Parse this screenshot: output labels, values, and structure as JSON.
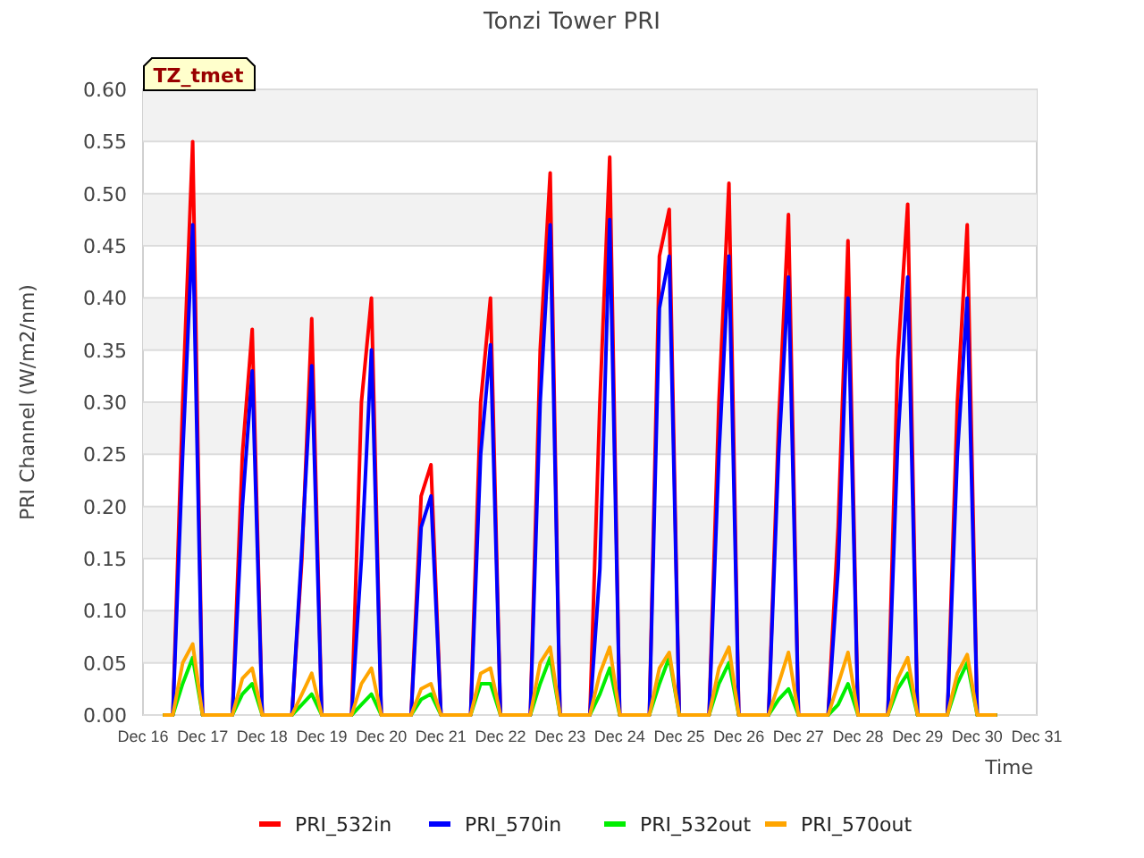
{
  "site_label": "TZ_tmet",
  "chart_data": {
    "type": "line",
    "title": "Tonzi Tower PRI",
    "xlabel": "Time",
    "ylabel": "PRI Channel (W/m2/nm)",
    "categories": [
      "Dec 16",
      null,
      null,
      null,
      null,
      null,
      "Dec 17",
      null,
      null,
      null,
      null,
      null,
      "Dec 18",
      null,
      null,
      null,
      null,
      null,
      "Dec 19",
      null,
      null,
      null,
      null,
      null,
      "Dec 20",
      null,
      null,
      null,
      null,
      null,
      "Dec 21",
      null,
      null,
      null,
      null,
      null,
      "Dec 22",
      null,
      null,
      null,
      null,
      null,
      "Dec 23",
      null,
      null,
      null,
      null,
      null,
      "Dec 24",
      null,
      null,
      null,
      null,
      null,
      "Dec 25",
      null,
      null,
      null,
      null,
      null,
      "Dec 26",
      null,
      null,
      null,
      null,
      null,
      "Dec 27",
      null,
      null,
      null,
      null,
      null,
      "Dec 28",
      null,
      null,
      null,
      null,
      null,
      "Dec 29",
      null,
      null,
      null,
      null,
      null,
      "Dec 30",
      null,
      null,
      null,
      null,
      null,
      "Dec 31"
    ],
    "series": [
      {
        "name": "PRI_532in",
        "color": "#ff0000",
        "values": [
          null,
          null,
          0,
          0,
          0.3,
          0.55,
          0,
          0,
          0,
          0,
          0.25,
          0.37,
          0,
          0,
          0,
          0,
          0.15,
          0.38,
          0,
          0,
          0,
          0,
          0.3,
          0.4,
          0,
          0,
          0,
          0,
          0.21,
          0.24,
          0,
          0,
          0,
          0,
          0.3,
          0.4,
          0,
          0,
          0,
          0,
          0.35,
          0.52,
          0,
          0,
          0,
          0,
          0.3,
          0.535,
          0,
          0,
          0,
          0,
          0.44,
          0.485,
          0,
          0,
          0,
          0,
          0.3,
          0.51,
          0,
          0,
          0,
          0,
          0.28,
          0.48,
          0,
          0,
          0,
          0,
          0.18,
          0.455,
          0,
          0,
          0,
          0,
          0.34,
          0.49,
          0,
          0,
          0,
          0,
          0.3,
          0.47,
          0,
          0,
          0,
          null,
          null,
          null,
          null
        ]
      },
      {
        "name": "PRI_570in",
        "color": "#0000ff",
        "values": [
          null,
          null,
          0,
          0,
          0.25,
          0.47,
          0,
          0,
          0,
          0,
          0.2,
          0.33,
          0,
          0,
          0,
          0,
          0.16,
          0.335,
          0,
          0,
          0,
          0,
          0.15,
          0.35,
          0,
          0,
          0,
          0,
          0.18,
          0.21,
          0,
          0,
          0,
          0,
          0.25,
          0.355,
          0,
          0,
          0,
          0,
          0.3,
          0.47,
          0,
          0,
          0,
          0,
          0.14,
          0.475,
          0,
          0,
          0,
          0,
          0.39,
          0.44,
          0,
          0,
          0,
          0,
          0.25,
          0.44,
          0,
          0,
          0,
          0,
          0.25,
          0.42,
          0,
          0,
          0,
          0,
          0.14,
          0.4,
          0,
          0,
          0,
          0,
          0.26,
          0.42,
          0,
          0,
          0,
          0,
          0.25,
          0.4,
          0,
          0,
          0,
          null,
          null,
          null,
          null
        ]
      },
      {
        "name": "PRI_532out",
        "color": "#00ee00",
        "values": [
          null,
          null,
          0,
          0,
          0.03,
          0.055,
          0,
          0,
          0,
          0,
          0.02,
          0.03,
          0,
          0,
          0,
          0,
          0.01,
          0.02,
          0,
          0,
          0,
          0,
          0.01,
          0.02,
          0,
          0,
          0,
          0,
          0.015,
          0.02,
          0,
          0,
          0,
          0,
          0.03,
          0.03,
          0,
          0,
          0,
          0,
          0.03,
          0.055,
          0,
          0,
          0,
          0,
          0.02,
          0.045,
          0,
          0,
          0,
          0,
          0.03,
          0.055,
          0,
          0,
          0,
          0,
          0.03,
          0.05,
          0,
          0,
          0,
          0,
          0.015,
          0.025,
          0,
          0,
          0,
          0,
          0.01,
          0.03,
          0,
          0,
          0,
          0,
          0.025,
          0.04,
          0,
          0,
          0,
          0,
          0.03,
          0.05,
          0,
          0,
          0,
          null,
          null,
          null,
          null
        ]
      },
      {
        "name": "PRI_570out",
        "color": "#ffa500",
        "values": [
          null,
          null,
          0,
          0,
          0.05,
          0.068,
          0,
          0,
          0,
          0,
          0.035,
          0.045,
          0,
          0,
          0,
          0,
          0.02,
          0.04,
          0,
          0,
          0,
          0,
          0.03,
          0.045,
          0,
          0,
          0,
          0,
          0.025,
          0.03,
          0,
          0,
          0,
          0,
          0.04,
          0.045,
          0,
          0,
          0,
          0,
          0.05,
          0.065,
          0,
          0,
          0,
          0,
          0.04,
          0.065,
          0,
          0,
          0,
          0,
          0.045,
          0.06,
          0,
          0,
          0,
          0,
          0.045,
          0.065,
          0,
          0,
          0,
          0,
          0.03,
          0.06,
          0,
          0,
          0,
          0,
          0.03,
          0.06,
          0,
          0,
          0,
          0,
          0.035,
          0.055,
          0,
          0,
          0,
          0,
          0.04,
          0.058,
          0,
          0,
          0,
          null,
          null,
          null,
          null
        ]
      }
    ],
    "ylim": [
      0,
      0.6
    ],
    "grid": true,
    "legend": true,
    "yticks": [
      {
        "value": 0,
        "label": "0.00"
      },
      {
        "value": 0.05,
        "label": "0.05"
      },
      {
        "value": 0.1,
        "label": "0.10"
      },
      {
        "value": 0.15,
        "label": "0.15"
      },
      {
        "value": 0.2,
        "label": "0.20"
      },
      {
        "value": 0.25,
        "label": "0.25"
      },
      {
        "value": 0.3,
        "label": "0.30"
      },
      {
        "value": 0.35,
        "label": "0.35"
      },
      {
        "value": 0.4,
        "label": "0.40"
      },
      {
        "value": 0.45,
        "label": "0.45"
      },
      {
        "value": 0.5,
        "label": "0.50"
      },
      {
        "value": 0.55,
        "label": "0.55"
      },
      {
        "value": 0.6,
        "label": "0.60"
      }
    ]
  }
}
